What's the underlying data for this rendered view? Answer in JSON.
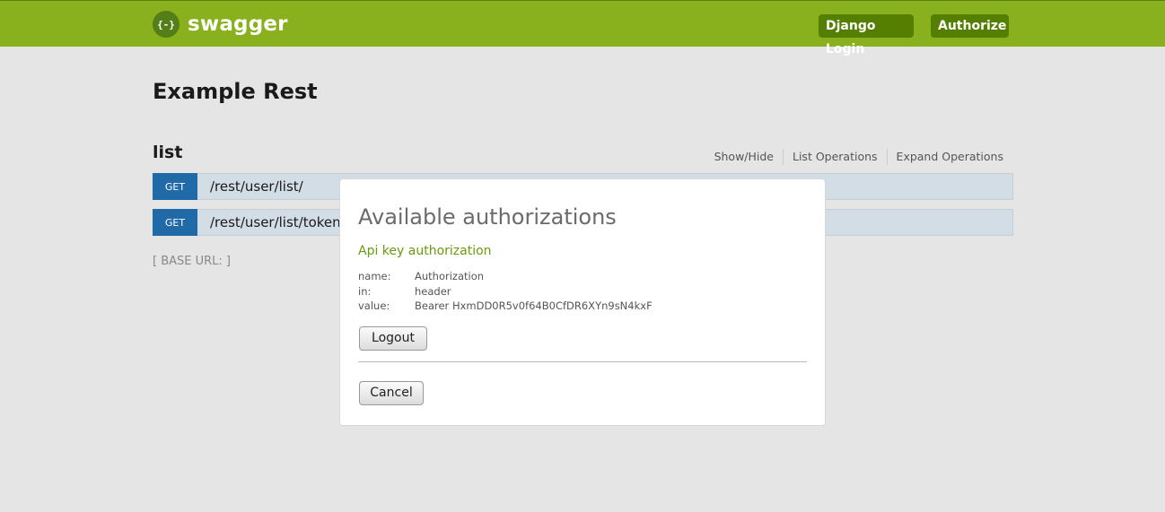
{
  "header": {
    "logo_icon": "{-}",
    "logo_text": "swagger",
    "django_login": "Django Login",
    "authorize": "Authorize",
    "colors": {
      "bar": "#89b01d",
      "button": "#547f00"
    }
  },
  "api": {
    "title": "Example Rest"
  },
  "resource": {
    "name": "list",
    "links": [
      "Show/Hide",
      "List Operations",
      "Expand Operations"
    ],
    "operations": [
      {
        "method": "GET",
        "path": "/rest/user/list/"
      },
      {
        "method": "GET",
        "path": "/rest/user/list/token"
      }
    ]
  },
  "base_url": "[ BASE URL: ]",
  "modal": {
    "title": "Available authorizations",
    "auth_name": "Api key authorization",
    "fields": [
      {
        "key": "name:",
        "value": "Authorization"
      },
      {
        "key": "in:",
        "value": "header"
      },
      {
        "key": "value:",
        "value": "Bearer HxmDD0R5v0f64B0CfDR6XYn9sN4kxF"
      }
    ],
    "logout_label": "Logout",
    "cancel_label": "Cancel"
  }
}
